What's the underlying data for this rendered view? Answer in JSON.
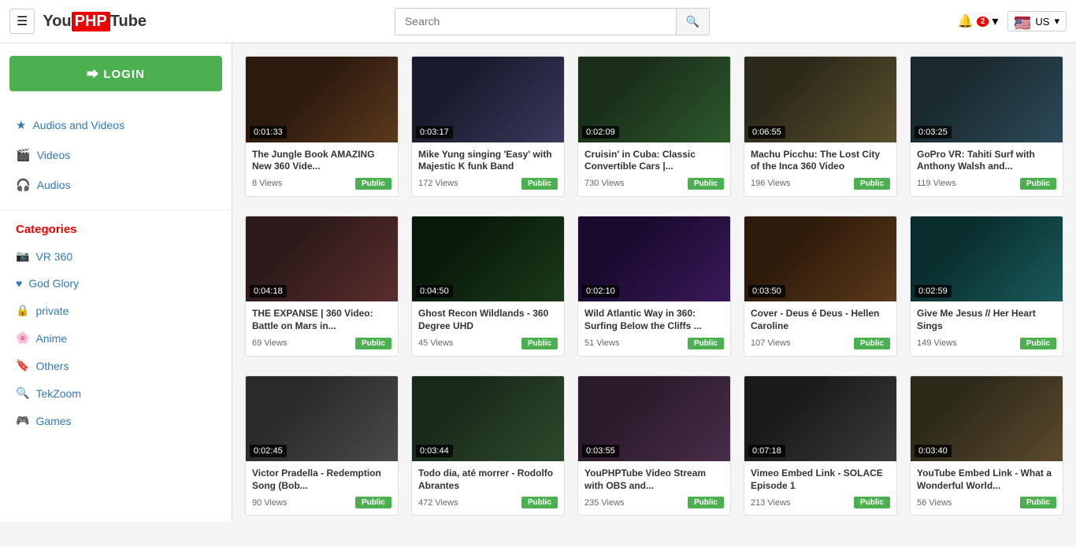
{
  "header": {
    "menu_label": "☰",
    "logo_you": "You",
    "logo_php": "PHP",
    "logo_tube": "Tube",
    "search_placeholder": "Search",
    "search_icon": "🔍",
    "notif_icon": "🔔",
    "notif_count": "2",
    "lang_flag": "🇺🇸",
    "lang_code": "US",
    "lang_arrow": "▾"
  },
  "sidebar": {
    "login_label": "⮕ LOGIN",
    "nav_items": [
      {
        "icon": "★",
        "label": "Audios and Videos"
      },
      {
        "icon": "🎬",
        "label": "Videos"
      },
      {
        "icon": "🎧",
        "label": "Audios"
      }
    ],
    "categories_title": "Categories",
    "categories": [
      {
        "icon": "📷",
        "label": "VR 360"
      },
      {
        "icon": "♥",
        "label": "God Glory"
      },
      {
        "icon": "🔒",
        "label": "private"
      },
      {
        "icon": "🌸",
        "label": "Anime"
      },
      {
        "icon": "🔖",
        "label": "Others"
      },
      {
        "icon": "🔍",
        "label": "TekZoom"
      },
      {
        "icon": "🎮",
        "label": "Games"
      }
    ]
  },
  "videos": {
    "rows": [
      {
        "items": [
          {
            "duration": "0:01:33",
            "title": "The Jungle Book AMAZING New 360 Vide...",
            "views": "8 Views",
            "public": "Public",
            "thumb": "thumb-1"
          },
          {
            "duration": "0:03:17",
            "title": "Mike Yung singing 'Easy' with Majestic K funk Band",
            "views": "172 Views",
            "public": "Public",
            "thumb": "thumb-2"
          },
          {
            "duration": "0:02:09",
            "title": "Cruisin' in Cuba: Classic Convertible Cars |...",
            "views": "730 Views",
            "public": "Public",
            "thumb": "thumb-3"
          },
          {
            "duration": "0:06:55",
            "title": "Machu Picchu: The Lost City of the Inca 360 Video",
            "views": "196 Views",
            "public": "Public",
            "thumb": "thumb-4"
          },
          {
            "duration": "0:03:25",
            "title": "GoPro VR: Tahiti Surf with Anthony Walsh and...",
            "views": "119 Views",
            "public": "Public",
            "thumb": "thumb-5"
          }
        ]
      },
      {
        "items": [
          {
            "duration": "0:04:18",
            "title": "THE EXPANSE | 360 Video: Battle on Mars in...",
            "views": "69 Views",
            "public": "Public",
            "thumb": "thumb-6"
          },
          {
            "duration": "0:04:50",
            "title": "Ghost Recon Wildlands - 360 Degree UHD",
            "views": "45 Views",
            "public": "Public",
            "thumb": "thumb-7"
          },
          {
            "duration": "0:02:10",
            "title": "Wild Atlantic Way in 360: Surfing Below the Cliffs ...",
            "views": "51 Views",
            "public": "Public",
            "thumb": "thumb-8"
          },
          {
            "duration": "0:03:50",
            "title": "Cover - Deus é Deus - Hellen Caroline",
            "views": "107 Views",
            "public": "Public",
            "thumb": "thumb-9"
          },
          {
            "duration": "0:02:59",
            "title": "Give Me Jesus // Her Heart Sings",
            "views": "149 Views",
            "public": "Public",
            "thumb": "thumb-10"
          }
        ]
      },
      {
        "items": [
          {
            "duration": "0:02:45",
            "title": "Victor Pradella - Redemption Song (Bob...",
            "views": "90 Views",
            "public": "Public",
            "thumb": "thumb-11"
          },
          {
            "duration": "0:03:44",
            "title": "Todo dia, até morrer - Rodolfo Abrantes",
            "views": "472 Views",
            "public": "Public",
            "thumb": "thumb-12"
          },
          {
            "duration": "0:03:55",
            "title": "YouPHPTube Video Stream with OBS and...",
            "views": "235 Views",
            "public": "Public",
            "thumb": "thumb-13"
          },
          {
            "duration": "0:07:18",
            "title": "Vimeo Embed Link - SOLACE Episode 1",
            "views": "213 Views",
            "public": "Public",
            "thumb": "thumb-14"
          },
          {
            "duration": "0:03:40",
            "title": "YouTube Embed Link - What a Wonderful World...",
            "views": "56 Views",
            "public": "Public",
            "thumb": "thumb-15"
          }
        ]
      }
    ]
  }
}
